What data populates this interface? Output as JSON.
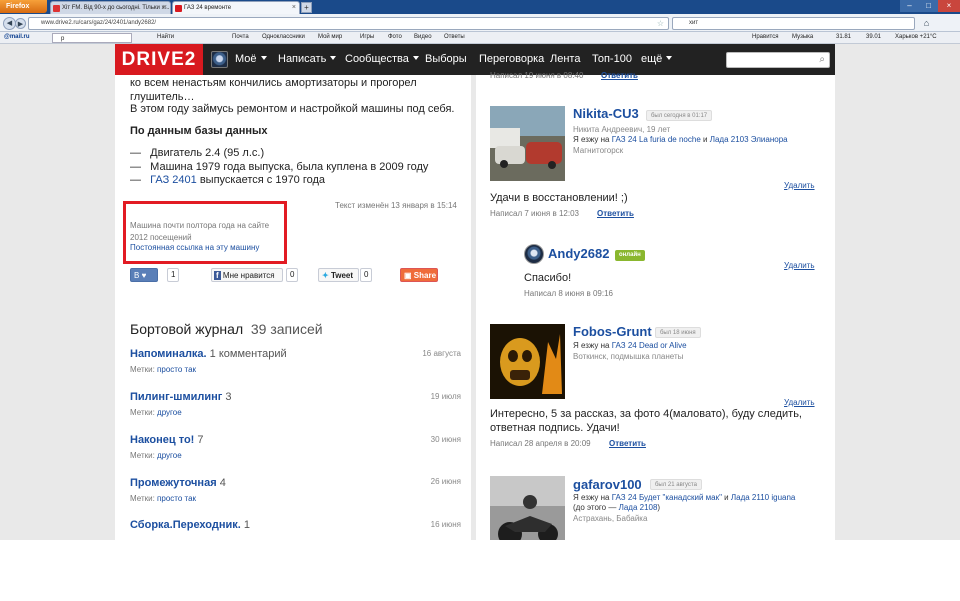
{
  "browser": {
    "firefox_label": "Firefox",
    "tabs": [
      {
        "label": "Хіт FM. Від 90-х до сьогодні. Тільки х..."
      },
      {
        "label": "ГАЗ 24 времонте"
      }
    ],
    "new_tab": "+",
    "url": "www.drive2.ru/cars/gaz/24/2401/andy2682/",
    "search_value": "хит",
    "toolbar": {
      "mailru": "@mail.ru",
      "search_value": "р",
      "find": "Найти",
      "items": [
        "Почта",
        "Одноклассники",
        "Мой мир",
        "Игры",
        "Фото",
        "Видео",
        "Ответы"
      ],
      "right_items": [
        "Нравится",
        "Музыка",
        "31.81",
        "39.01",
        "Харьков +21°C"
      ]
    }
  },
  "site": {
    "logo": "DRIVE2",
    "nav": [
      "Моё",
      "Написать",
      "Сообщества",
      "Выборы",
      "Переговорка",
      "Лента",
      "Топ-100",
      "ещё"
    ]
  },
  "car": {
    "text_lines": [
      "ко всем ненастьям кончились амортизаторы и прогорел",
      "глушитель…",
      "В этом году займусь ремонтом и настройкой машины под себя."
    ],
    "db_title": "По данным базы данных",
    "db_items": [
      "Двигатель 2.4 (95 л.с.)",
      "Машина 1979 года выпуска, была куплена в 2009 году"
    ],
    "db_item3_link": "ГАЗ 2401",
    "db_item3_rest": " выпускается с 1970 года",
    "dash": "—",
    "text_changed": "Текст изменён 13 января в 15:14",
    "stats": {
      "on_site": "Машина почти полтора года на сайте",
      "visits": "2012 посещений",
      "permalink": "Постоянная ссылка на эту машину"
    },
    "social": {
      "b_label": "В",
      "b_count": "1",
      "fb_label": "Мне нравится",
      "fb_count": "0",
      "tweet_label": "Tweet",
      "tweet_count": "0",
      "share_label": "Share"
    }
  },
  "journal": {
    "title": "Бортовой журнал",
    "count": "39 записей",
    "tags_label": "Метки:",
    "entries": [
      {
        "title": "Напоминалка.",
        "extra": "1 комментарий",
        "date": "16 августа",
        "tag": "просто так"
      },
      {
        "title": "Пилинг-шмилинг",
        "extra": "3",
        "date": "19 июля",
        "tag": "другое"
      },
      {
        "title": "Наконец то!",
        "extra": "7",
        "date": "30 июня",
        "tag": "другое"
      },
      {
        "title": "Промежуточная",
        "extra": "4",
        "date": "26 июня",
        "tag": "просто так"
      },
      {
        "title": "Сборка.Переходник.",
        "extra": "1",
        "date": "16 июня",
        "tag": ""
      }
    ]
  },
  "comments": {
    "top_posted": "Написал 19 июня в 08:40",
    "reply_label": "Ответить",
    "delete_label": "Удалить",
    "drive_label": "Я езжу на",
    "list": [
      {
        "user": "Nikita-CU3",
        "badge": "был сегодня в 01:17",
        "info": "Никита Андреевич, 19 лет",
        "car1": "ГАЗ 24 La furia de noche",
        "and": "и",
        "car2": "Лада 2103 Элианора",
        "city": "Магнитогорск",
        "text": "Удачи в восстановлении! ;)",
        "posted": "Написал 7 июня в 12:03"
      },
      {
        "user": "Andy2682",
        "badge": "онлайн",
        "text": "Спасибо!",
        "posted": "Написал 8 июня в 09:16"
      },
      {
        "user": "Fobos-Grunt",
        "badge": "был 18 июня",
        "car1": "ГАЗ 24 Dead or Alive",
        "city": "Воткинск, подмышка планеты",
        "text1": "Интересно, 5 за рассказ, за фото 4(маловато), буду следить,",
        "text2": "ответная подпись. Удачи!",
        "posted": "Написал 28 апреля в 20:09"
      },
      {
        "user": "gafarov100",
        "badge": "был 21 августа",
        "car1": "ГАЗ 24 Будет \"канадский мак\"",
        "and": "и",
        "car2": "Лада 2110 iguana",
        "before": "(до этого — ",
        "before_link": "Лада 2108",
        "before_end": ")",
        "city": "Астрахань, Бабайка"
      }
    ]
  }
}
